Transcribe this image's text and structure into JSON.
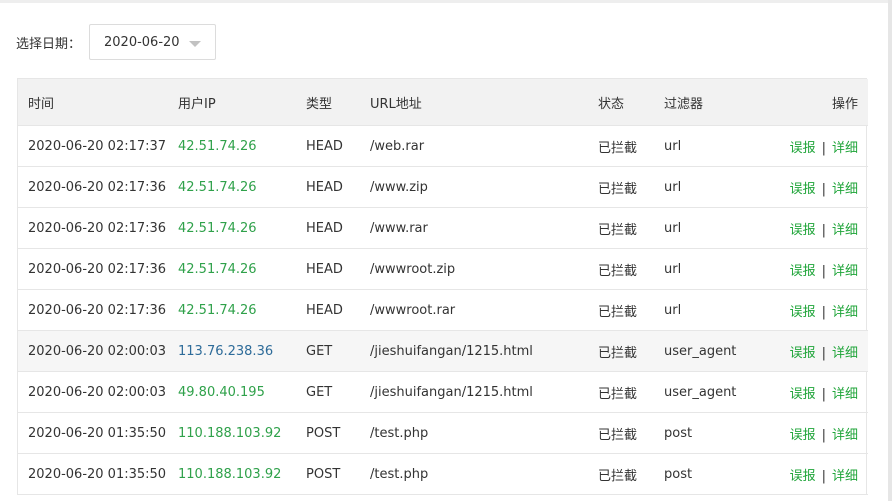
{
  "filter": {
    "label": "选择日期：",
    "date_value": "2020-06-20"
  },
  "table": {
    "headers": {
      "time": "时间",
      "ip": "用户IP",
      "type": "类型",
      "url": "URL地址",
      "status": "状态",
      "filter": "过滤器",
      "ops": "操作"
    },
    "action_labels": {
      "misreport": "误报",
      "separator": "|",
      "detail": "详细"
    },
    "rows": [
      {
        "time": "2020-06-20 02:17:37",
        "ip": "42.51.74.26",
        "type": "HEAD",
        "url": "/web.rar",
        "status": "已拦截",
        "filter": "url"
      },
      {
        "time": "2020-06-20 02:17:36",
        "ip": "42.51.74.26",
        "type": "HEAD",
        "url": "/www.zip",
        "status": "已拦截",
        "filter": "url"
      },
      {
        "time": "2020-06-20 02:17:36",
        "ip": "42.51.74.26",
        "type": "HEAD",
        "url": "/www.rar",
        "status": "已拦截",
        "filter": "url"
      },
      {
        "time": "2020-06-20 02:17:36",
        "ip": "42.51.74.26",
        "type": "HEAD",
        "url": "/wwwroot.zip",
        "status": "已拦截",
        "filter": "url"
      },
      {
        "time": "2020-06-20 02:17:36",
        "ip": "42.51.74.26",
        "type": "HEAD",
        "url": "/wwwroot.rar",
        "status": "已拦截",
        "filter": "url"
      },
      {
        "time": "2020-06-20 02:00:03",
        "ip": "113.76.238.36",
        "type": "GET",
        "url": "/jieshuifangan/1215.html",
        "status": "已拦截",
        "filter": "user_agent"
      },
      {
        "time": "2020-06-20 02:00:03",
        "ip": "49.80.40.195",
        "type": "GET",
        "url": "/jieshuifangan/1215.html",
        "status": "已拦截",
        "filter": "user_agent"
      },
      {
        "time": "2020-06-20 01:35:50",
        "ip": "110.188.103.92",
        "type": "POST",
        "url": "/test.php",
        "status": "已拦截",
        "filter": "post"
      },
      {
        "time": "2020-06-20 01:35:50",
        "ip": "110.188.103.92",
        "type": "POST",
        "url": "/test.php",
        "status": "已拦截",
        "filter": "post"
      }
    ]
  },
  "colors": {
    "link_green": "#20a53a",
    "ip_green": "#2fa14a",
    "ip_blue": "#2d6b99",
    "header_bg": "#f2f2f2",
    "hover_row_bg": "#f6f6f6"
  }
}
